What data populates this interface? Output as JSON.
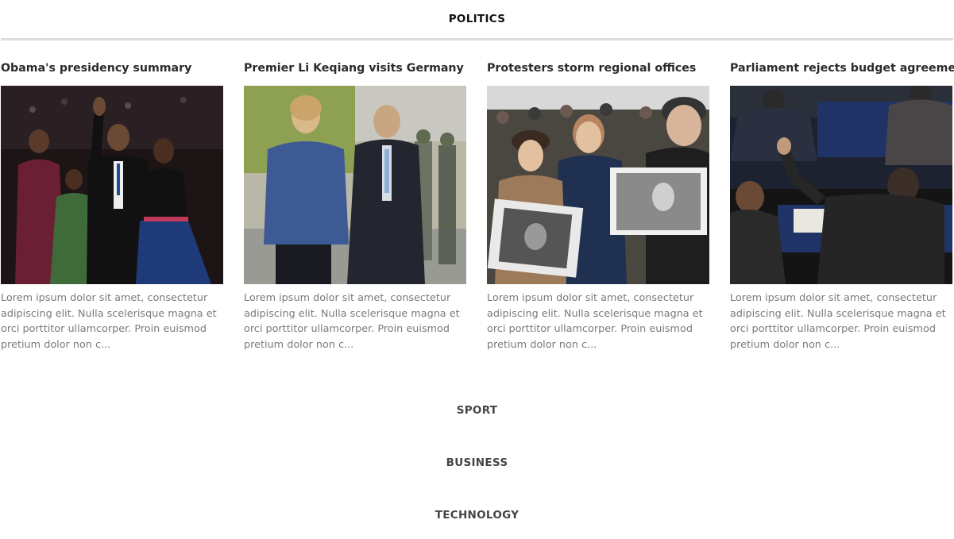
{
  "sections": {
    "active": "POLITICS",
    "others": [
      "SPORT",
      "BUSINESS",
      "TECHNOLOGY"
    ]
  },
  "articles": [
    {
      "title": "Obama's presidency summary",
      "excerpt": "Lorem ipsum dolor sit amet, consectetur adipiscing elit. Nulla scelerisque magna et orci porttitor ullamcorper. Proin euismod pretium dolor non c..."
    },
    {
      "title": "Premier Li Keqiang visits Germany",
      "excerpt": "Lorem ipsum dolor sit amet, consectetur adipiscing elit. Nulla scelerisque magna et orci porttitor ullamcorper. Proin euismod pretium dolor non c..."
    },
    {
      "title": "Protesters storm regional offices",
      "excerpt": "Lorem ipsum dolor sit amet, consectetur adipiscing elit. Nulla scelerisque magna et orci porttitor ullamcorper. Proin euismod pretium dolor non c..."
    },
    {
      "title": "Parliament rejects budget agreement",
      "excerpt": "Lorem ipsum dolor sit amet, consectetur adipiscing elit. Nulla scelerisque magna et orci porttitor ullamcorper. Proin euismod pretium dolor non c..."
    }
  ]
}
